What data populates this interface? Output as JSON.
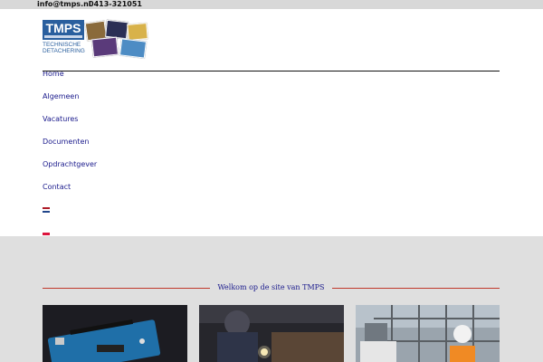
{
  "topbar": {
    "email": "info@tmps.nl",
    "phone": "0413-321051"
  },
  "logo": {
    "name": "TMPS",
    "tagline_line1": "TECHNISCHE",
    "tagline_line2": "DETACHERING"
  },
  "nav": {
    "items": [
      "Home",
      "Algemeen",
      "Vacatures",
      "Documenten",
      "Opdrachtgever",
      "Contact"
    ],
    "active": "Home",
    "flags": [
      "flag-netherlands-icon",
      "flag-poland-icon"
    ]
  },
  "welcome": {
    "title": "Welkom op de site van TMPS"
  },
  "colors": {
    "nav_link": "#1a1a8c",
    "accent_line": "#c0392b",
    "brand_blue": "#2a5f9e"
  },
  "cards": [
    {
      "image": "arduino-board-photo"
    },
    {
      "image": "welder-at-work-photo"
    },
    {
      "image": "construction-worker-photo"
    }
  ]
}
